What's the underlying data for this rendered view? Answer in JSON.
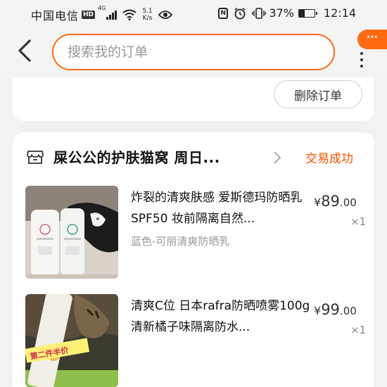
{
  "status_bar": {
    "carrier": "中国电信",
    "hd": "HD",
    "net_type": "4G",
    "speed_value": "5.1",
    "speed_unit": "K/s",
    "nfc": "N",
    "battery_percent": "37%",
    "battery_level": 0.37,
    "time": "12:14"
  },
  "nav": {
    "search_placeholder": "搜索我的订单",
    "badge": "···"
  },
  "prev_order": {
    "delete_label": "删除订单"
  },
  "order": {
    "shop_name": "屎公公的护肤猫窝 周日...",
    "status": "交易成功",
    "items": [
      {
        "title": "炸裂的清爽肤感 爱斯德玛防晒乳SPF50 妆前隔离自然...",
        "sku": "蓝色-可丽清爽防晒乳",
        "currency": "¥",
        "price_int": "89",
        "price_dec": ".00",
        "qty": "×1"
      },
      {
        "title": "清爽C位 日本rafra防晒喷雾100g 清新橘子味隔离防水...",
        "sku": "",
        "currency": "¥",
        "price_int": "99",
        "price_dec": ".00",
        "qty": "×1",
        "photo_caption": "第二件半价"
      }
    ]
  },
  "colors": {
    "accent": "#ff6a13",
    "status_text": "#ff5000",
    "page_bg": "#f2f2f2"
  }
}
